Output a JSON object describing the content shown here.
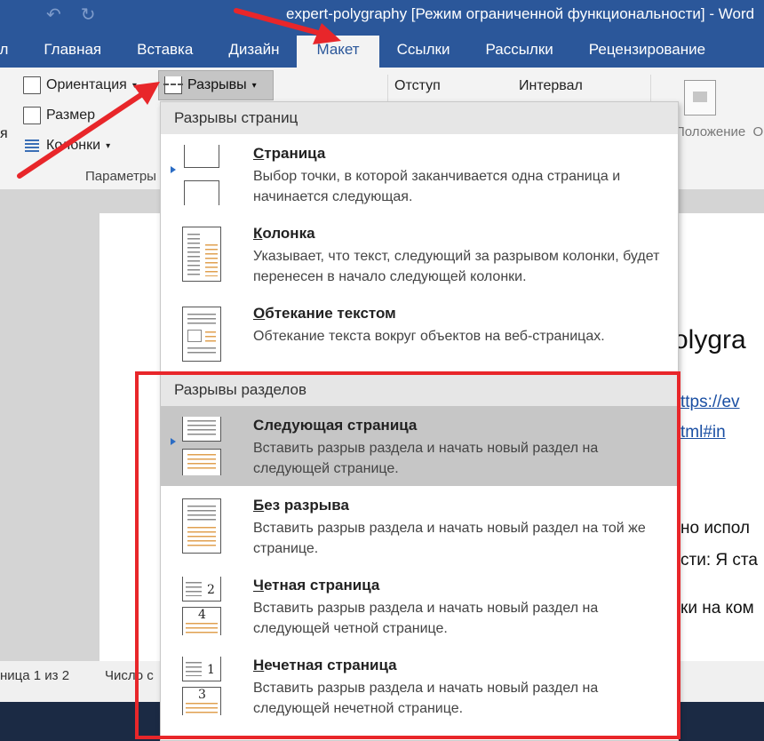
{
  "window": {
    "title": "expert-polygraphy [Режим ограниченной функциональности] - Word"
  },
  "quick_access": {
    "undo_icon": "undo-arrow-icon",
    "redo_icon": "redo-icon",
    "file_tab_fragment": "йл"
  },
  "tabs": [
    {
      "label": "Главная"
    },
    {
      "label": "Вставка"
    },
    {
      "label": "Дизайн"
    },
    {
      "label": "Макет",
      "active": true
    },
    {
      "label": "Ссылки"
    },
    {
      "label": "Рассылки"
    },
    {
      "label": "Рецензирование"
    }
  ],
  "ribbon": {
    "orientation": "Ориентация",
    "size": "Размер",
    "columns": "Колонки",
    "breaks": "Разрывы",
    "indent": "Отступ",
    "spacing": "Интервал",
    "group_label": "Параметры",
    "left_fragment": "я",
    "position": "Положение",
    "position_fragment": "О"
  },
  "menu": {
    "page_breaks_header": "Разрывы страниц",
    "section_breaks_header": "Разрывы разделов",
    "items": [
      {
        "title": "Страница",
        "accel": "С",
        "rest": "траница",
        "desc": "Выбор точки, в которой заканчивается одна страница и начинается следующая."
      },
      {
        "title": "Колонка",
        "accel": "К",
        "rest": "олонка",
        "desc": "Указывает, что текст, следующий за разрывом колонки, будет перенесен в начало следующей колонки."
      },
      {
        "title": "Обтекание текстом",
        "accel": "О",
        "rest": "бтекание текстом",
        "desc": "Обтекание текста вокруг объектов на веб-страницах."
      },
      {
        "title": "Следующая страница",
        "accel": "",
        "rest": "Следующая страница",
        "desc": "Вставить разрыв раздела и начать новый раздел на следующей странице."
      },
      {
        "title": "Без разрыва",
        "accel": "Б",
        "rest": "ез разрыва",
        "desc": "Вставить разрыв раздела и начать новый раздел на той же странице."
      },
      {
        "title": "Четная страница",
        "accel": "Ч",
        "rest": "етная страница",
        "desc": "Вставить разрыв раздела и начать новый раздел на следующей четной странице."
      },
      {
        "title": "Нечетная страница",
        "accel": "Н",
        "rest": "ечетная страница",
        "desc": "Вставить разрыв раздела и начать новый раздел на следующей нечетной странице."
      }
    ],
    "icon_numbers": {
      "even_top": "2",
      "even_bottom": "4",
      "odd_top": "1",
      "odd_bottom": "3"
    }
  },
  "document": {
    "heading_fragment": "olygra",
    "link1_fragment": "ttps://ev",
    "link2_fragment": "tml#in",
    "line1_fragment": "но испол",
    "line2_fragment": "сти: Я ста",
    "line3_fragment": "ки на ком"
  },
  "status": {
    "page": "ница 1 из 2",
    "words": "Число с"
  },
  "annotations": {
    "color": "#e8262a"
  }
}
